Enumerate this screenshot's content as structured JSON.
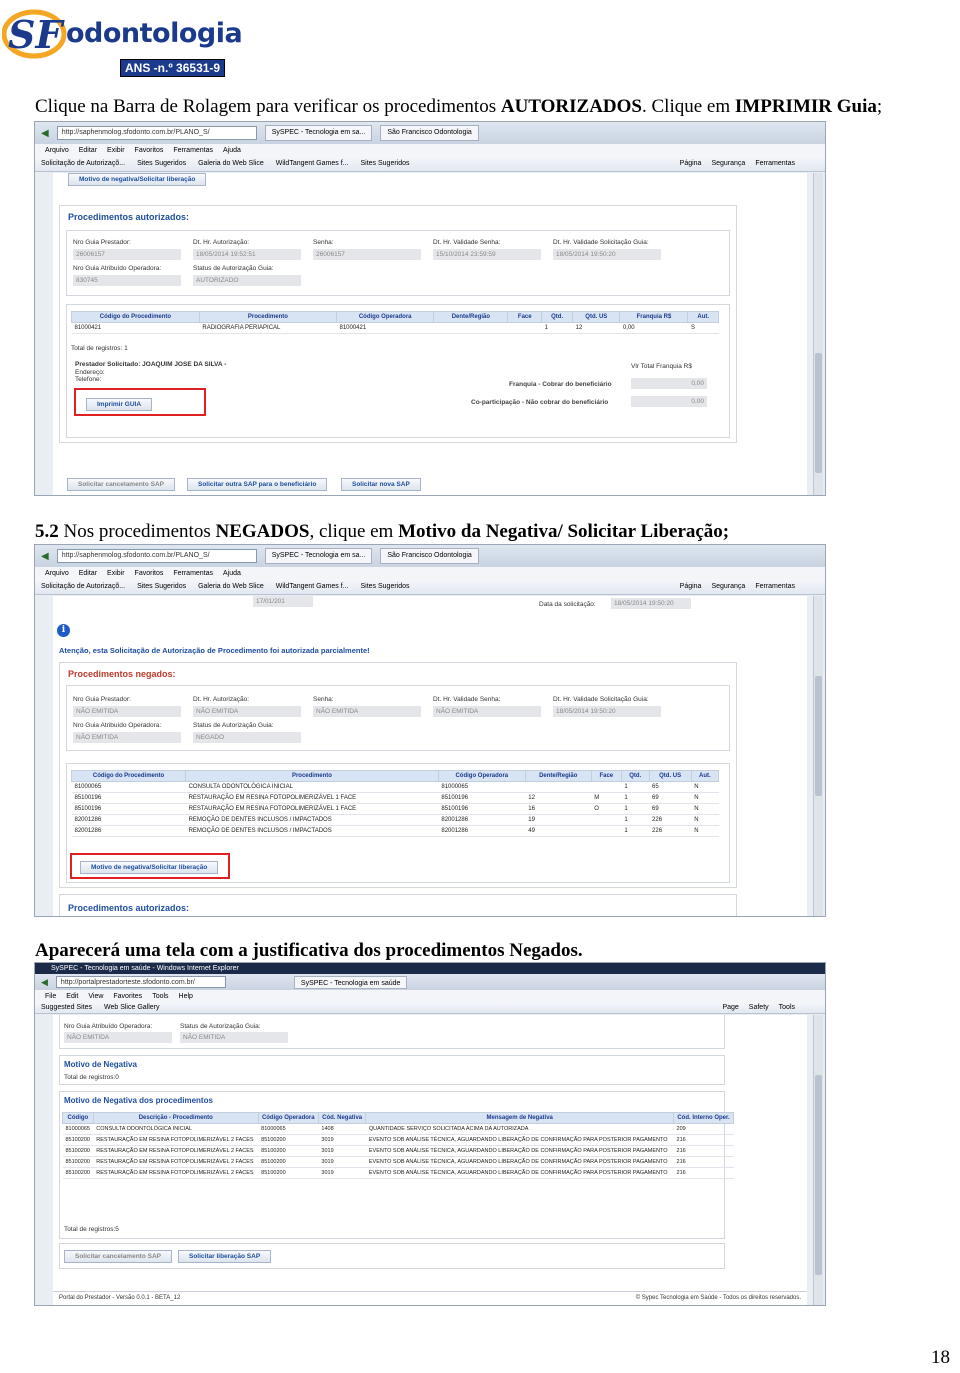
{
  "logo": {
    "brand": "odontologia",
    "ans": "ANS -n.º 36531-9"
  },
  "instr1": {
    "p1": "Clique na Barra de Rolagem para verificar os procedimentos ",
    "b1": "AUTORIZADOS",
    "p2": ". Clique em ",
    "b2": "IMPRIMIR Guia",
    "p3": ";"
  },
  "instr2": {
    "num": "5.2",
    "p1": " Nos procedimentos ",
    "b1": "NEGADOS",
    "p2": ", clique em ",
    "b2": "Motivo da Negativa/ Solicitar Liberação;"
  },
  "instr3": {
    "text": "Aparecerá uma tela com a justificativa dos procedimentos Negados."
  },
  "browser1": {
    "address": "http://saphenmolog.sfodonto.com.br/PLANO_S/",
    "tab1": "SySPEC - Tecnologia em sa...",
    "tab2": "São Francisco Odontologia",
    "menu": [
      "Arquivo",
      "Editar",
      "Exibir",
      "Favoritos",
      "Ferramentas",
      "Ajuda"
    ],
    "favs": [
      "Solicitação de Autorizaçõ...",
      "Sites Sugeridos",
      "Galeria do Web Slice",
      "WildTangent Games f...",
      "Sites Sugeridos"
    ],
    "right": [
      "Página",
      "Segurança",
      "Ferramentas"
    ]
  },
  "s1": {
    "top_btn": "Motivo de negativa/Solicitar liberação",
    "title": "Procedimentos autorizados:",
    "fields": [
      {
        "label": "Nro Guia Prestador:",
        "value": "26006157"
      },
      {
        "label": "Dt. Hr. Autorização:",
        "value": "18/05/2014 19:52:51"
      },
      {
        "label": "Senha:",
        "value": "26006157"
      },
      {
        "label": "Dt. Hr. Validade Senha:",
        "value": "15/10/2014 23:59:59"
      },
      {
        "label": "Dt. Hr. Validade Solicitação Guia:",
        "value": "18/05/2014 19:50:20"
      },
      {
        "label": "Nro Guia Atribuído Operadora:",
        "value": "830745"
      },
      {
        "label": "Status de Autorização Guia:",
        "value": "AUTORIZADO"
      }
    ],
    "columns": [
      "Código do Procedimento",
      "Procedimento",
      "Código Operadora",
      "Dente/Região",
      "Face",
      "Qtd.",
      "Qtd. US",
      "Franquia R$",
      "Aut."
    ],
    "rows": [
      [
        "81000421",
        "RADIOGRAFIA PERIAPICAL",
        "81000421",
        "",
        "",
        "1",
        "12",
        "0,00",
        "S"
      ]
    ],
    "total": "Total de registros: 1",
    "prestador": "Prestador Solicitado: JOAQUIM JOSE DA SILVA -",
    "endereco": "Endereço:",
    "telefone": "Telefone:",
    "vlr_total": "Vlr Total Franquia R$",
    "franquia": "Franquia - Cobrar do beneficiário",
    "franquia_val": "0,00",
    "copart": "Co-participação - Não cobrar do beneficiário",
    "copart_val": "0,00",
    "print_btn": "Imprimir GUIA",
    "bottom_btns": [
      "Solicitar cancelamento SAP",
      "Solicitar outra SAP para o beneficiário",
      "Solicitar nova SAP"
    ]
  },
  "s2": {
    "top_value": "17/01/201",
    "date_label": "Data da solicitação:",
    "date_value": "18/05/2014 19:50:20",
    "attention": "Atenção, esta Solicitação de Autorização de Procedimento foi autorizada parcialmente!",
    "title": "Procedimentos negados:",
    "fields": [
      {
        "label": "Nro Guia Prestador:",
        "value": "NÃO EMITIDA"
      },
      {
        "label": "Dt. Hr. Autorização:",
        "value": "NÃO EMITIDA"
      },
      {
        "label": "Senha:",
        "value": "NÃO EMITIDA"
      },
      {
        "label": "Dt. Hr. Validade Senha:",
        "value": "NÃO EMITIDA"
      },
      {
        "label": "Dt. Hr. Validade Solicitação Guia:",
        "value": "18/05/2014 19:50:20"
      },
      {
        "label": "Nro Guia Atribuído Operadora:",
        "value": "NÃO EMITIDA"
      },
      {
        "label": "Status de Autorização Guia:",
        "value": "NEGADO"
      }
    ],
    "columns": [
      "Código do Procedimento",
      "Procedimento",
      "Código Operadora",
      "Dente/Região",
      "Face",
      "Qtd.",
      "Qtd. US",
      "Aut."
    ],
    "rows": [
      [
        "81000065",
        "CONSULTA ODONTOLÓGICA INICIAL",
        "81000065",
        "",
        "",
        "1",
        "65",
        "N"
      ],
      [
        "85100196",
        "RESTAURAÇÃO EM RESINA FOTOPOLIMERIZÁVEL 1 FACE",
        "85100196",
        "12",
        "M",
        "1",
        "69",
        "N"
      ],
      [
        "85100196",
        "RESTAURAÇÃO EM RESINA FOTOPOLIMERIZÁVEL 1 FACE",
        "85100196",
        "16",
        "O",
        "1",
        "69",
        "N"
      ],
      [
        "82001286",
        "REMOÇÃO DE DENTES INCLUSOS / IMPACTADOS",
        "82001286",
        "19",
        "",
        "1",
        "226",
        "N"
      ],
      [
        "82001286",
        "REMOÇÃO DE DENTES INCLUSOS / IMPACTADOS",
        "82001286",
        "49",
        "",
        "1",
        "226",
        "N"
      ]
    ],
    "motivo_btn": "Motivo de negativa/Solicitar liberação",
    "title2": "Procedimentos autorizados:"
  },
  "browser3": {
    "window_title": "SySPEC - Tecnologia em saúde - Windows Internet Explorer",
    "address": "http://portalprestadorteste.sfodonto.com.br/",
    "tab": "SySPEC - Tecnologia em saúde",
    "menu": [
      "File",
      "Edit",
      "View",
      "Favorites",
      "Tools",
      "Help"
    ],
    "favs": [
      "Suggested Sites",
      "Web Slice Gallery"
    ],
    "right": [
      "Page",
      "Safety",
      "Tools"
    ]
  },
  "s3": {
    "fields": [
      {
        "label": "Nro Guia Atribuído Operadora:",
        "value": "NÃO EMITIDA"
      },
      {
        "label": "Status de Autorização Guia:",
        "value": "NÃO EMITIDA"
      }
    ],
    "motivo_title": "Motivo de Negativa",
    "motivo_total": "Total de registros:0",
    "proc_title": "Motivo de Negativa dos procedimentos",
    "columns": [
      "Código",
      "Descrição - Procedimento",
      "Código Operadora",
      "Cód. Negativa",
      "Mensagem de Negativa",
      "Cód. Interno Oper."
    ],
    "rows": [
      [
        "81000065",
        "CONSULTA ODONTOLÓGICA INICIAL",
        "81000065",
        "1408",
        "QUANTIDADE SERVIÇO SOLICITADA ACIMA DA AUTORIZADA",
        "209"
      ],
      [
        "85100200",
        "RESTAURAÇÃO EM RESINA FOTOPOLIMERIZÁVEL 2 FACES",
        "85100200",
        "3019",
        "EVENTO SOB ANÁLISE TÉCNICA, AGUARDANDO LIBERAÇÃO DE CONFIRMAÇÃO PARA POSTERIOR PAGAMENTO",
        "216"
      ],
      [
        "85100200",
        "RESTAURAÇÃO EM RESINA FOTOPOLIMERIZÁVEL 2 FACES",
        "85100200",
        "3019",
        "EVENTO SOB ANÁLISE TÉCNICA, AGUARDANDO LIBERAÇÃO DE CONFIRMAÇÃO PARA POSTERIOR PAGAMENTO",
        "216"
      ],
      [
        "85100200",
        "RESTAURAÇÃO EM RESINA FOTOPOLIMERIZÁVEL 2 FACES",
        "85100200",
        "3019",
        "EVENTO SOB ANÁLISE TÉCNICA, AGUARDANDO LIBERAÇÃO DE CONFIRMAÇÃO PARA POSTERIOR PAGAMENTO",
        "216"
      ],
      [
        "85100200",
        "RESTAURAÇÃO EM RESINA FOTOPOLIMERIZÁVEL 2 FACES",
        "85100200",
        "3019",
        "EVENTO SOB ANÁLISE TÉCNICA, AGUARDANDO LIBERAÇÃO DE CONFIRMAÇÃO PARA POSTERIOR PAGAMENTO",
        "216"
      ]
    ],
    "total": "Total de registros:5",
    "btn_cancel": "Solicitar cancelamento SAP",
    "btn_lib": "Solicitar liberação SAP",
    "footer_left": "Portal do Prestador - Versão 0.0.1 - BETA_12",
    "footer_right": "© Sypec Tecnologia em Saúde - Todos os direitos reservados."
  },
  "page_number": "18"
}
